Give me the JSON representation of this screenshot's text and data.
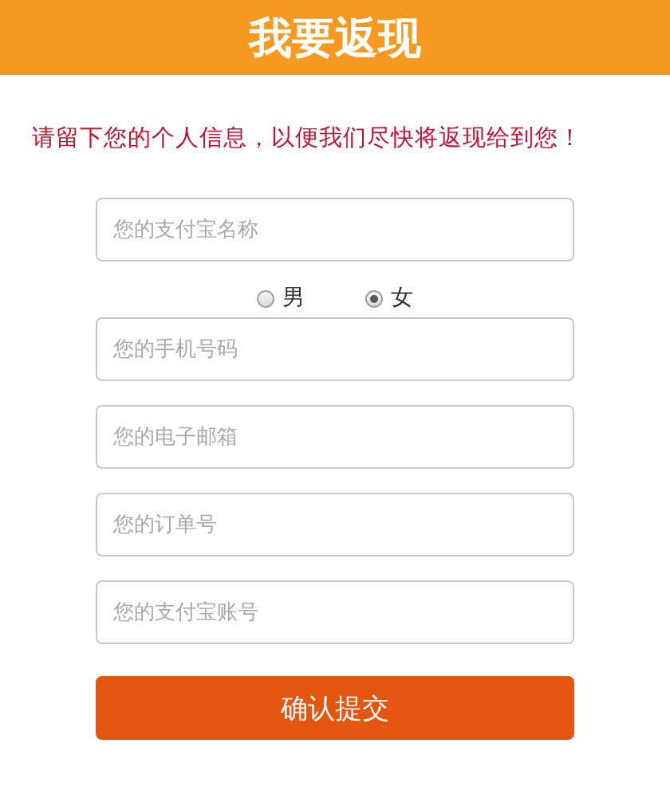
{
  "header": {
    "title": "我要返现"
  },
  "message": "请留下您的个人信息，以便我们尽快将返现给到您！",
  "fields_top": [
    {
      "placeholder": "您的支付宝名称"
    }
  ],
  "gender": [
    {
      "label": "男",
      "selected": false
    },
    {
      "label": "女",
      "selected": true
    }
  ],
  "fields": [
    {
      "placeholder": "您的手机号码"
    },
    {
      "placeholder": "您的电子邮箱"
    },
    {
      "placeholder": "您的订单号"
    },
    {
      "placeholder": "您的支付宝账号"
    }
  ],
  "submit": "确认提交"
}
